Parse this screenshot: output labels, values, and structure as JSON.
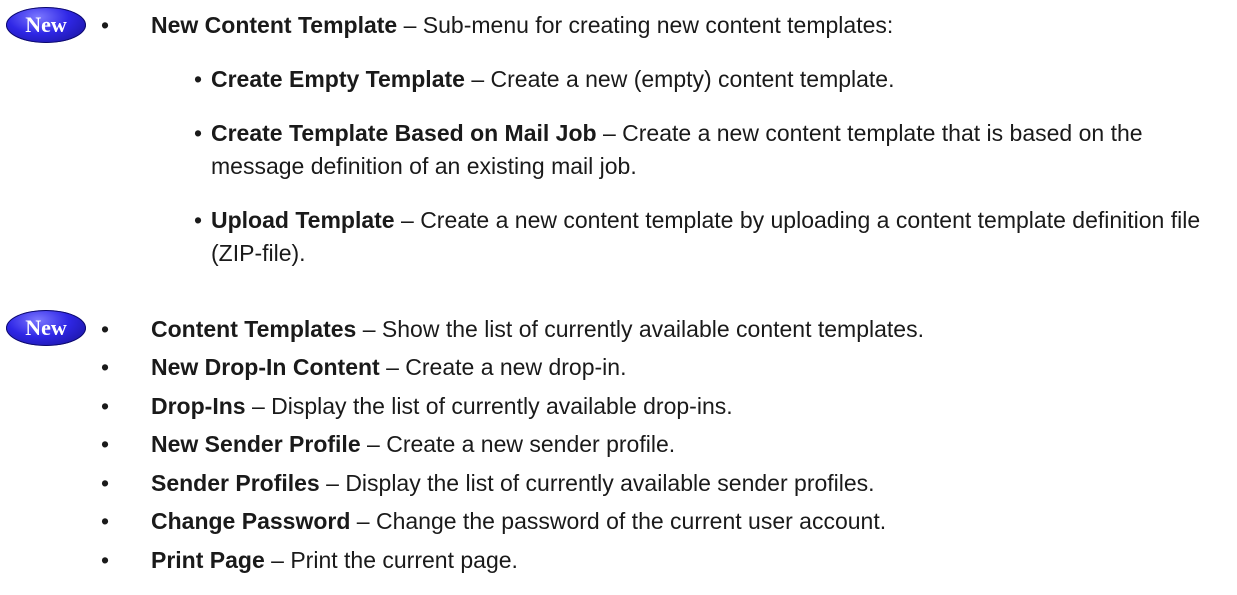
{
  "badge_label": "New",
  "bullet_char": "•",
  "dash": " – ",
  "items": [
    {
      "term": "New Content Template",
      "desc": "Sub-menu for creating new content templates:"
    },
    {
      "term": "Content Templates",
      "desc": "Show the list of currently available content templates."
    },
    {
      "term": "New Drop-In Content",
      "desc": "Create a new drop-in."
    },
    {
      "term": "Drop-Ins",
      "desc": "Display the list of currently available drop-ins."
    },
    {
      "term": "New Sender Profile",
      "desc": "Create a new sender profile."
    },
    {
      "term": "Sender Profiles",
      "desc": "Display the list of currently available sender profiles."
    },
    {
      "term": "Change Password",
      "desc": "Change the password of the current user account."
    },
    {
      "term": "Print Page",
      "desc": "Print the current page."
    }
  ],
  "subitems": [
    {
      "term": "Create Empty Template",
      "desc": "Create a new (empty) content template."
    },
    {
      "term": "Create Template Based on Mail Job",
      "desc": "Create a new content template that is based on the message definition of an existing mail job."
    },
    {
      "term": "Upload Template",
      "desc": "Create a new content template by uploading a content template definition file (ZIP-file)."
    }
  ],
  "badge_color": "#2f27e6"
}
